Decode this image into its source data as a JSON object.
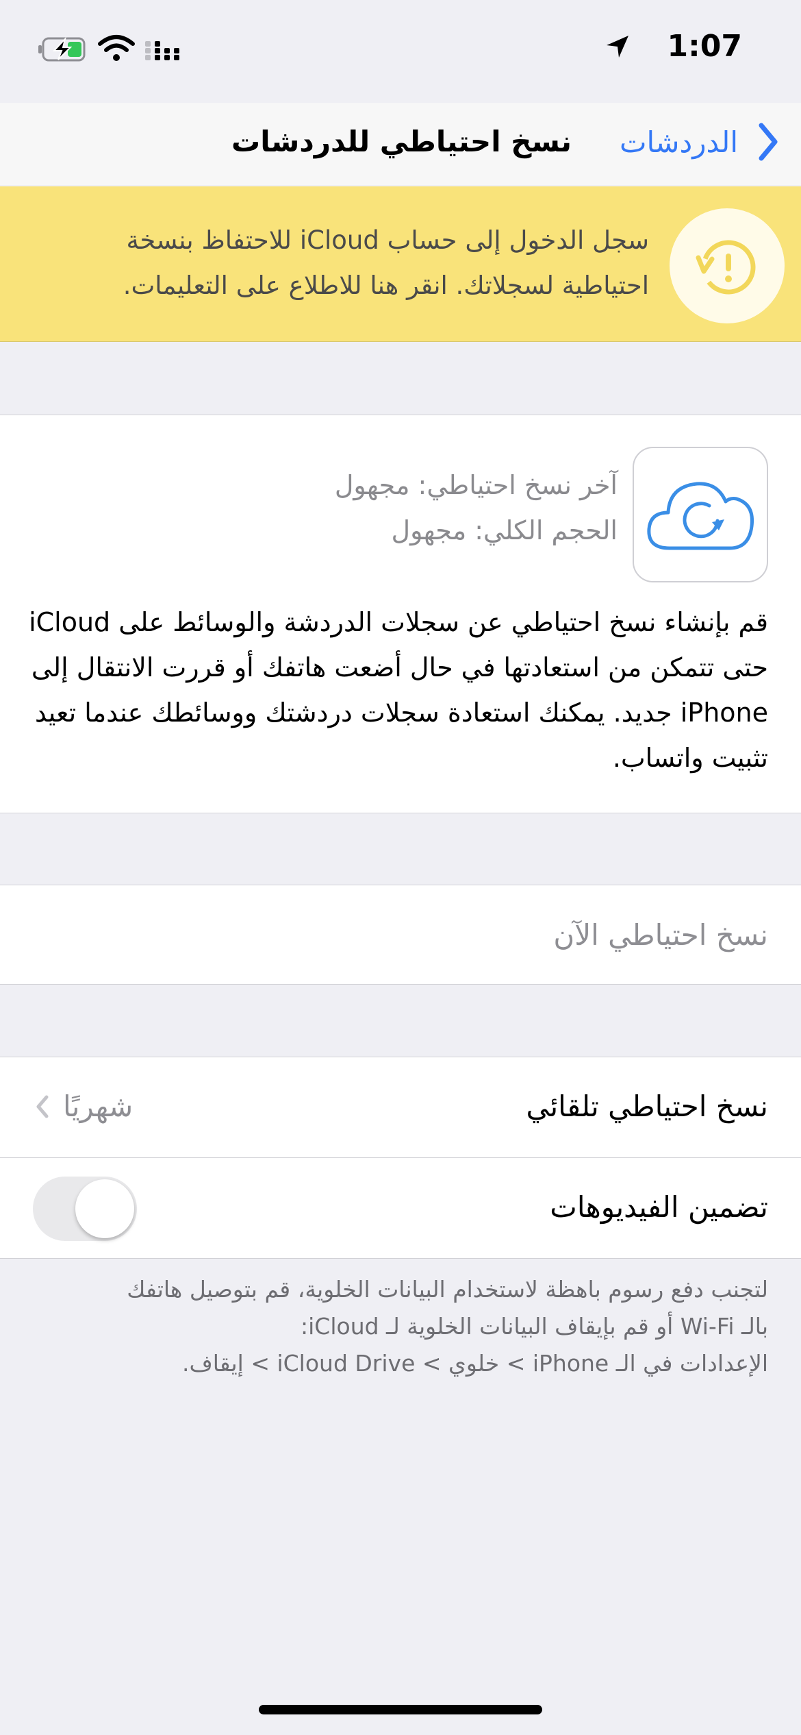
{
  "status_bar": {
    "time": "1:07"
  },
  "nav": {
    "back_label": "الدردشات",
    "title": "نسخ احتياطي للدردشات"
  },
  "banner": {
    "text": "سجل الدخول إلى حساب iCloud للاحتفاظ بنسخة احتياطية لسجلاتك. انقر هنا للاطلاع على التعليمات."
  },
  "backup_info": {
    "last_backup": "آخر نسخ احتياطي: مجهول",
    "total_size": "الحجم الكلي: مجهول",
    "description": "قم بإنشاء نسخ احتياطي عن سجلات الدردشة والوسائط على iCloud حتى تتمكن من استعادتها في حال أضعت هاتفك أو قررت الانتقال إلى iPhone جديد. يمكنك استعادة سجلات دردشتك ووسائطك عندما تعيد تثبيت واتساب."
  },
  "backup_now": {
    "label": "نسخ احتياطي الآن"
  },
  "auto_backup": {
    "label": "نسخ احتياطي تلقائي",
    "value": "شهريًا"
  },
  "include_videos": {
    "label": "تضمين الفيديوهات",
    "enabled": false
  },
  "footer_note": {
    "line1": "لتجنب دفع رسوم باهظة لاستخدام البيانات الخلوية، قم بتوصيل هاتفك",
    "line2": "بالـ Wi-Fi أو قم بإيقاف البيانات الخلوية لـ iCloud:",
    "line3": "الإعدادات في الـ iPhone > خلوي > iCloud Drive > إيقاف."
  },
  "colors": {
    "accent": "#3478f6",
    "banner_bg": "#f9e37a",
    "page_bg": "#efeff4",
    "icon_blue": "#3a8ee6",
    "banner_icon": "#f2d75a"
  },
  "icons": {
    "status": [
      "battery-charging-icon",
      "wifi-icon",
      "cellular-signal-icon",
      "location-arrow-icon"
    ],
    "nav": "chevron-left-icon",
    "banner": "backup-alert-icon",
    "cloud": "icloud-sync-icon",
    "row": "chevron-left-icon"
  }
}
